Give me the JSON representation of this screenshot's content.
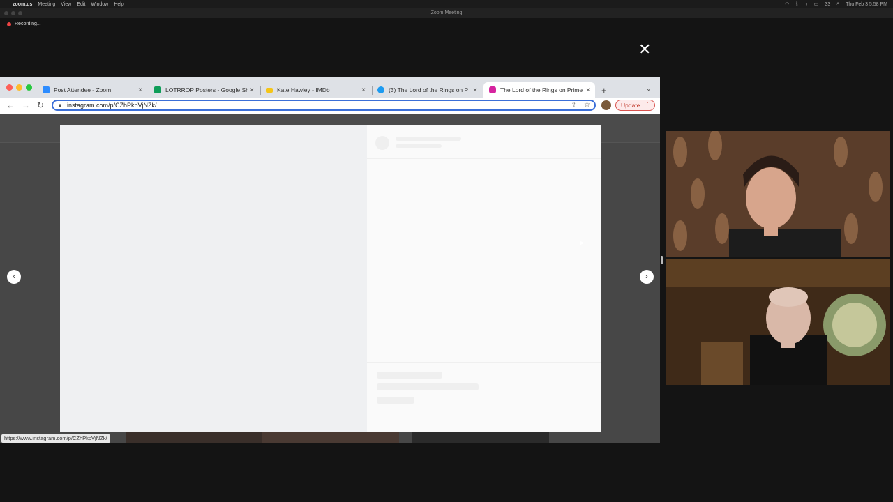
{
  "menubar": {
    "apple": "",
    "app": "zoom.us",
    "items": [
      "Meeting",
      "View",
      "Edit",
      "Window",
      "Help"
    ],
    "battery_pct": "33",
    "clock": "Thu Feb 3 5:58 PM"
  },
  "zoom": {
    "window_title": "Zoom Meeting",
    "recording_label": "Recording..."
  },
  "browser": {
    "tabs": [
      {
        "title": "Post Attendee - Zoom",
        "favicon_color": "#2d8cff",
        "favicon": "zoom-favicon-icon",
        "active": false
      },
      {
        "title": "LOTRROP Posters - Google Sh",
        "favicon_color": "#0f9d58",
        "favicon": "sheets-favicon-icon",
        "active": false
      },
      {
        "title": "Kate Hawley - IMDb",
        "favicon_color": "#f5c518",
        "favicon": "imdb-favicon-icon",
        "active": false
      },
      {
        "title": "(3) The Lord of the Rings on P",
        "favicon_color": "#1d9bf0",
        "favicon": "twitter-favicon-icon",
        "active": false
      },
      {
        "title": "The Lord of the Rings on Prime",
        "favicon_color": "#d6249f",
        "favicon": "instagram-favicon-icon",
        "active": true
      }
    ],
    "url": "instagram.com/p/CZhPkpVjNZk/",
    "update_label": "Update",
    "status_url": "https://www.instagram.com/p/CZhPkpVjNZk/",
    "accent_color": "#3b6fd8"
  },
  "modal": {
    "close_symbol": "✕",
    "prev_symbol": "‹",
    "next_symbol": "›"
  }
}
